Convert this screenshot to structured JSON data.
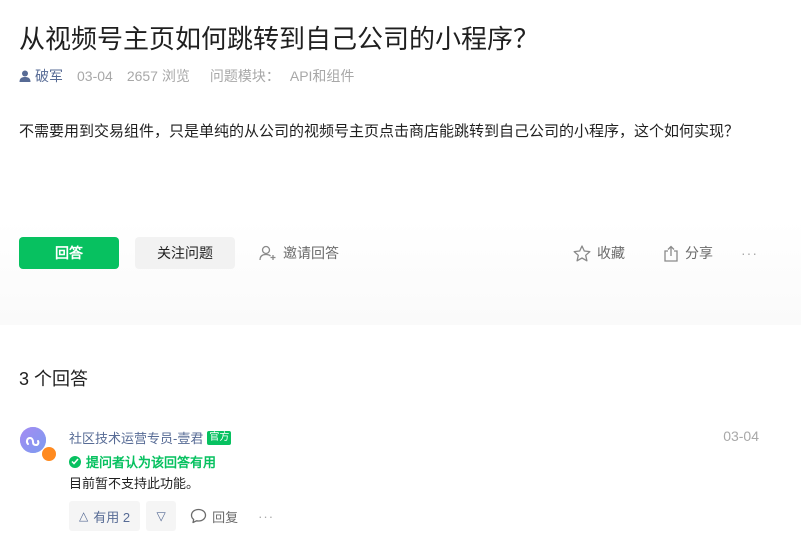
{
  "question": {
    "title": "从视频号主页如何跳转到自己公司的小程序？",
    "author": "破军",
    "date": "03-04",
    "views": "2657 浏览",
    "module_label": "问题模块：",
    "module_value": "API和组件",
    "body": "不需要用到交易组件，只是单纯的从公司的视频号主页点击商店能跳转到自己公司的小程序，这个如何实现？"
  },
  "actions": {
    "answer_label": "回答",
    "follow_label": "关注问题",
    "invite_label": "邀请回答",
    "favorite_label": "收藏",
    "share_label": "分享",
    "more_label": "···"
  },
  "answers_count_label": "3 个回答",
  "answers": [
    {
      "author": "社区技术运营专员-壹君",
      "badge": "官方",
      "date": "03-04",
      "helpful_note": "提问者认为该回答有用",
      "body": "目前暂不支持此功能。",
      "upvote_label": "有用 2",
      "upvote_icon": "△",
      "downvote_icon": "▽",
      "reply_label": "回复",
      "more_label": "···"
    }
  ],
  "colors": {
    "accent_green": "#07c160",
    "link_blue": "#576b95",
    "muted_gray": "#a8a8a8"
  }
}
